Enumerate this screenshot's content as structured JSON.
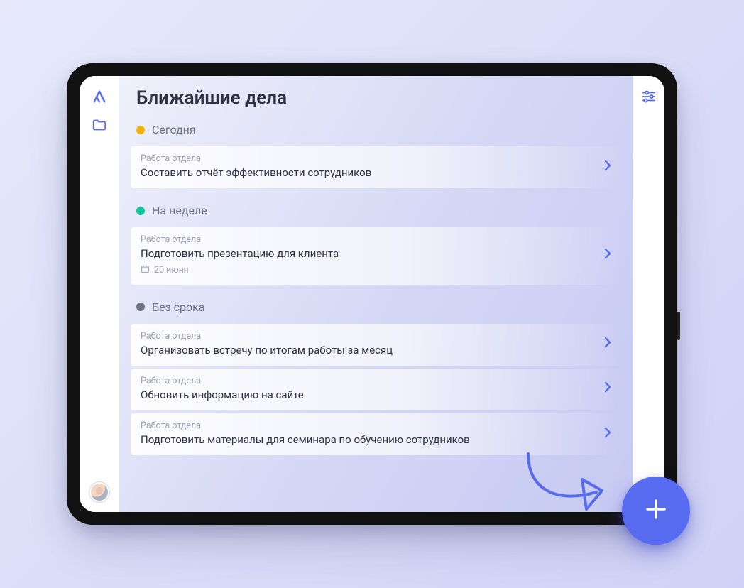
{
  "header": {
    "title": "Ближайшие дела"
  },
  "sections": [
    {
      "key": "today",
      "label": "Сегодня",
      "dotClass": "today"
    },
    {
      "key": "week",
      "label": "На неделе",
      "dotClass": "week"
    },
    {
      "key": "nodue",
      "label": "Без срока",
      "dotClass": "nodue"
    }
  ],
  "tasks": {
    "today": [
      {
        "category": "Работа отдела",
        "title": "Составить отчёт эффективности сотрудников"
      }
    ],
    "week": [
      {
        "category": "Работа отдела",
        "title": "Подготовить презентацию для клиента",
        "date": "20 июня"
      }
    ],
    "nodue": [
      {
        "category": "Работа отдела",
        "title": "Организовать встречу по итогам работы за месяц"
      },
      {
        "category": "Работа отдела",
        "title": "Обновить информацию на сайте"
      },
      {
        "category": "Работа отдела",
        "title": "Подготовить материалы для семинара по обучению сотрудников"
      }
    ]
  },
  "icons": {
    "logo": "logo-icon",
    "folder": "folder-icon",
    "settings": "sliders-icon",
    "calendar": "calendar-icon",
    "chevron": "chevron-right-icon",
    "plus": "plus-icon",
    "arrow": "callout-arrow-icon"
  },
  "colors": {
    "accent": "#566bf0"
  }
}
